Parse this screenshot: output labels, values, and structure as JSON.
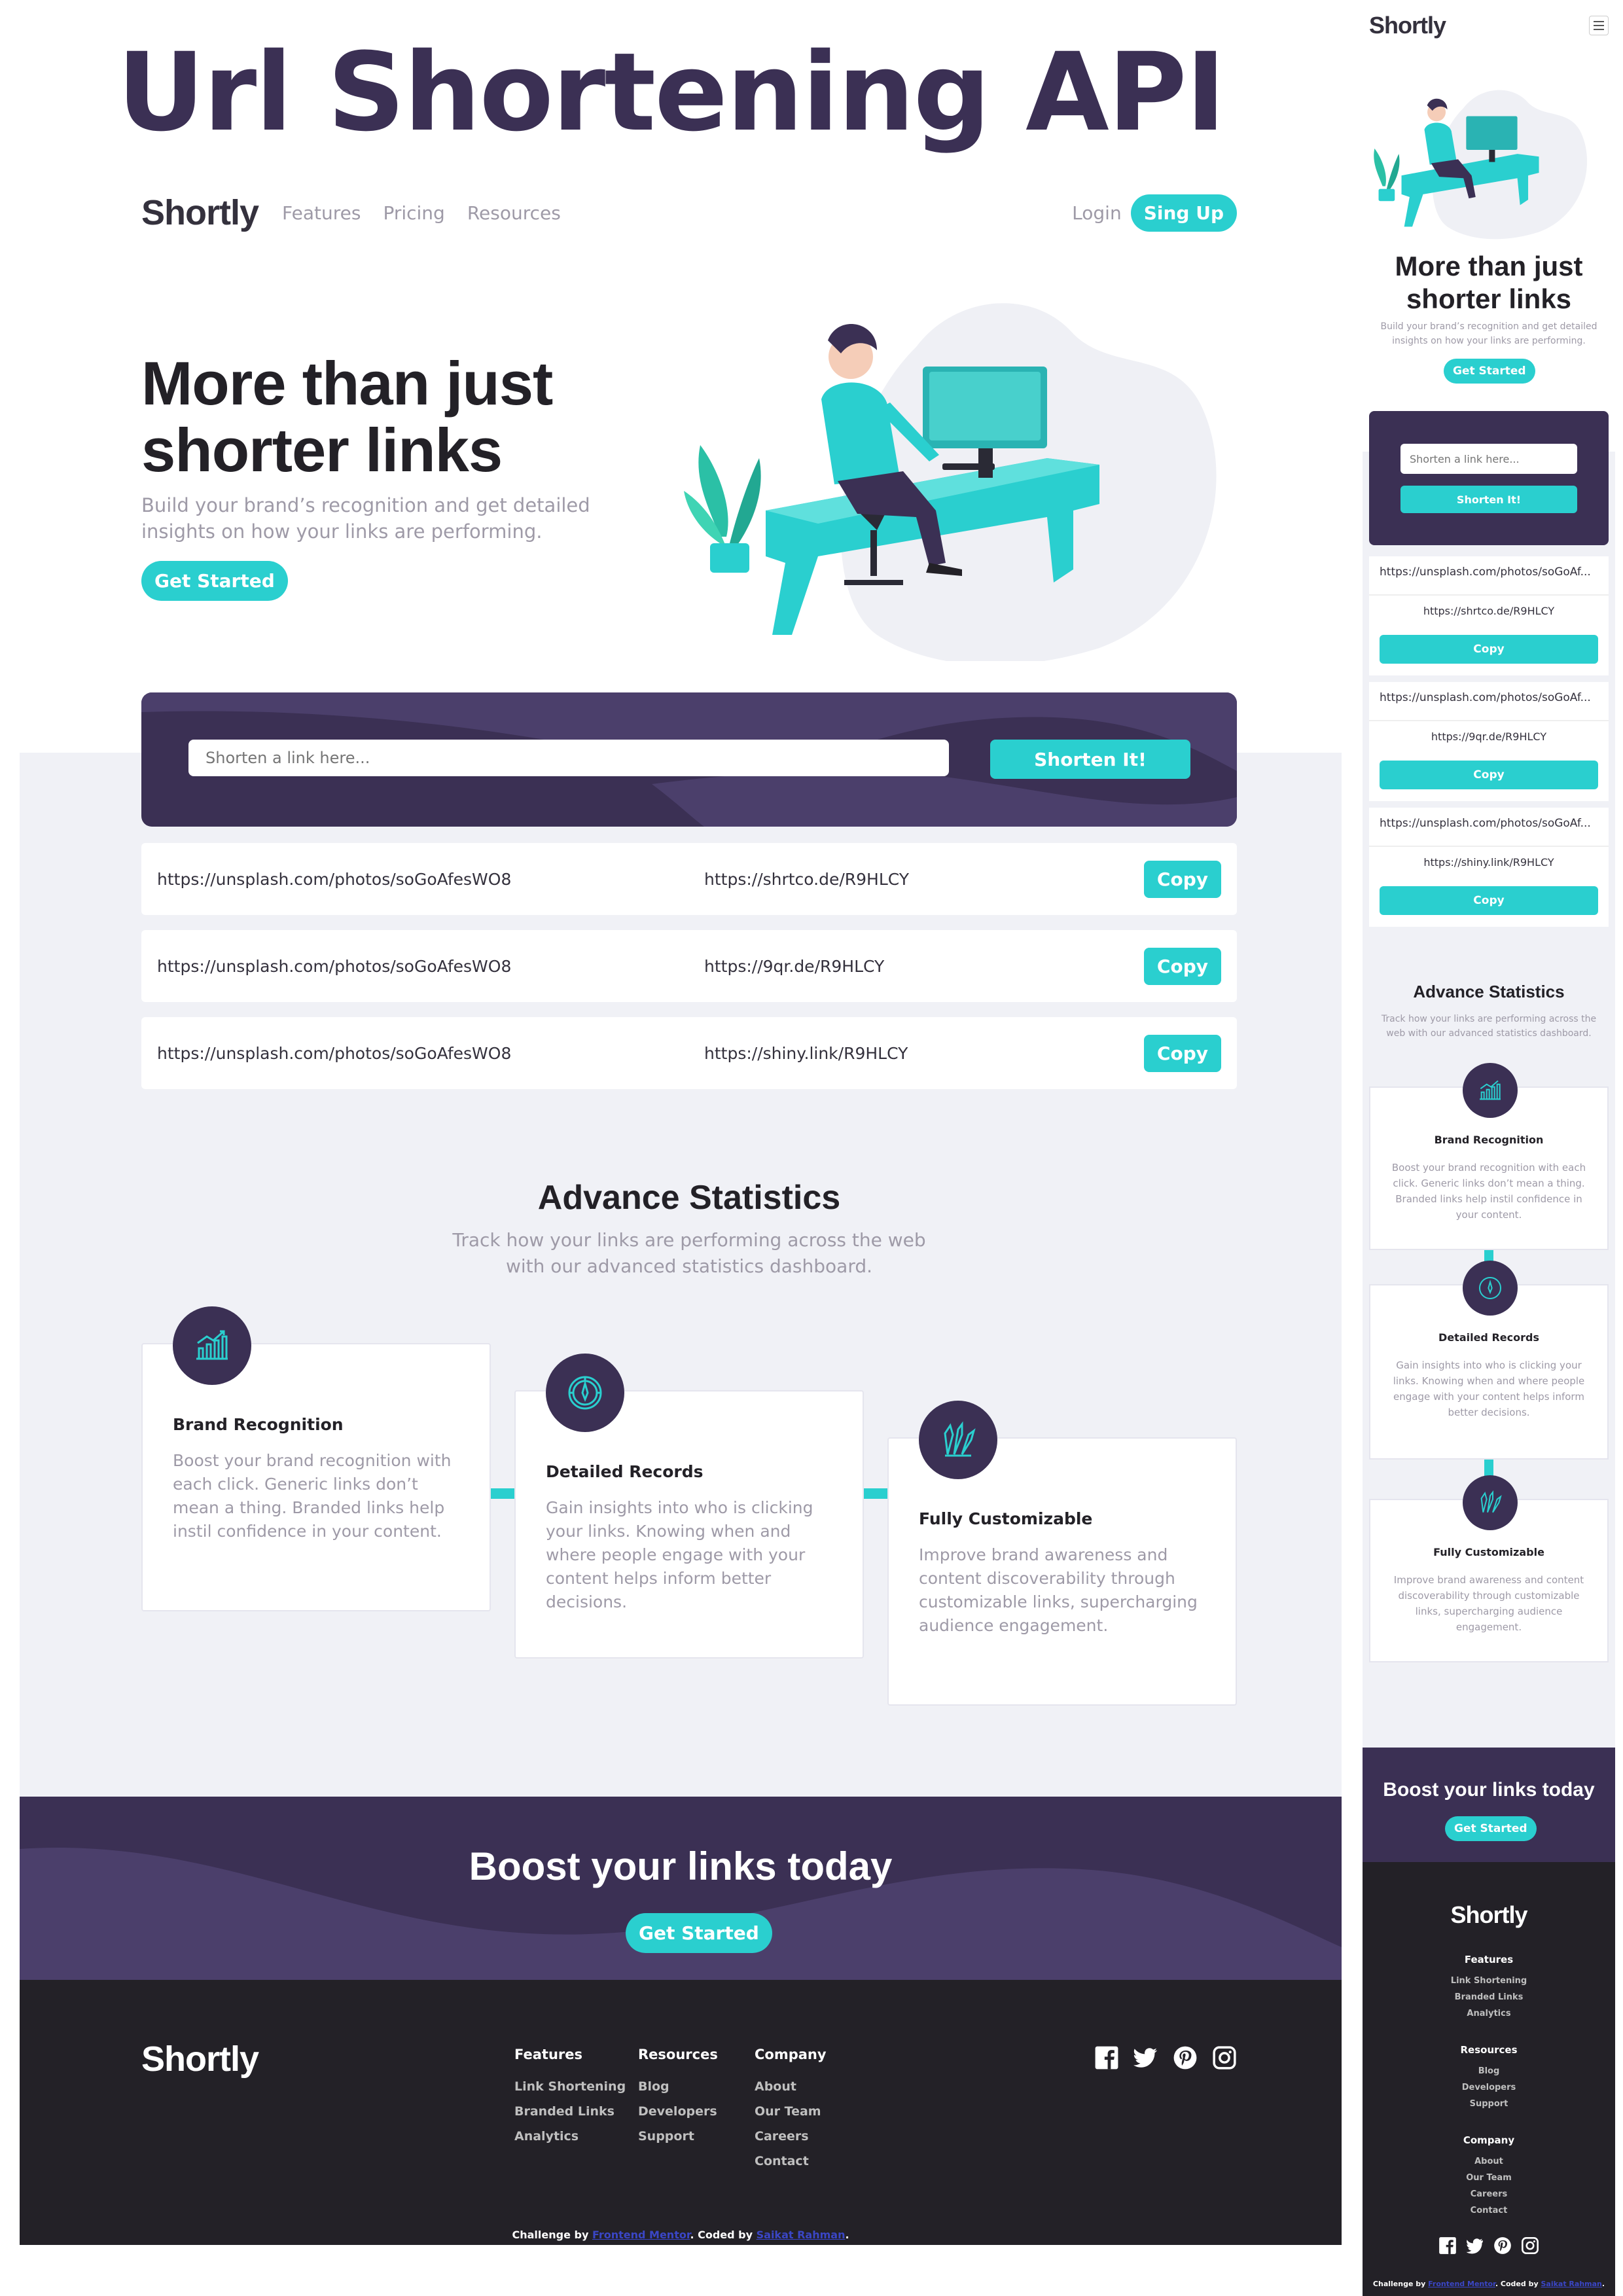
{
  "page_title": "Url Shortening API",
  "brand": "Shortly",
  "nav": {
    "links": [
      "Features",
      "Pricing",
      "Resources"
    ],
    "login": "Login",
    "signup": "Sing Up"
  },
  "hero": {
    "title": "More than just shorter links",
    "subtitle": "Build your brand’s recognition and get detailed insights on how your links are performing.",
    "cta": "Get Started"
  },
  "shorten": {
    "placeholder": "Shorten a link here...",
    "button": "Shorten It!"
  },
  "results": [
    {
      "original": "https://unsplash.com/photos/soGoAfesWO8",
      "short": "https://shrtco.de/R9HLCY",
      "copy": "Copy"
    },
    {
      "original": "https://unsplash.com/photos/soGoAfesWO8",
      "short": "https://9qr.de/R9HLCY",
      "copy": "Copy"
    },
    {
      "original": "https://unsplash.com/photos/soGoAfesWO8",
      "short": "https://shiny.link/R9HLCY",
      "copy": "Copy"
    }
  ],
  "stats": {
    "title": "Advance Statistics",
    "subtitle": "Track how your links are performing across the web with our advanced statistics dashboard.",
    "cards": [
      {
        "icon": "brand-recognition-icon",
        "title": "Brand Recognition",
        "text": "Boost your brand recognition with each click. Generic links don’t mean a thing. Branded links help instil confidence in your content."
      },
      {
        "icon": "detailed-records-icon",
        "title": "Detailed Records",
        "text": "Gain insights into who is clicking your links. Knowing when and where people engage with your content helps inform better decisions."
      },
      {
        "icon": "fully-customizable-icon",
        "title": "Fully Customizable",
        "text": "Improve brand awareness and content discoverability through customizable links, supercharging audience engagement."
      }
    ]
  },
  "boost": {
    "title": "Boost your links today",
    "cta": "Get Started"
  },
  "footer": {
    "columns": [
      {
        "title": "Features",
        "links": [
          "Link Shortening",
          "Branded Links",
          "Analytics"
        ]
      },
      {
        "title": "Resources",
        "links": [
          "Blog",
          "Developers",
          "Support"
        ]
      },
      {
        "title": "Company",
        "links": [
          "About",
          "Our Team",
          "Careers",
          "Contact"
        ]
      }
    ],
    "social": [
      "facebook-icon",
      "twitter-icon",
      "pinterest-icon",
      "instagram-icon"
    ],
    "credit": {
      "challenge_prefix": "Challenge by ",
      "challenge_link": "Frontend Mentor",
      "coded_prefix": ". Coded by ",
      "coded_link": "Saikat Rahman",
      "suffix": "."
    }
  },
  "mobile": {
    "results_original_truncated": "https://unsplash.com/photos/soGoAf..."
  },
  "colors": {
    "cyan": "#2acfcf",
    "dark_violet": "#3b3054",
    "very_dark_violet": "#232127",
    "gray": "#9e9aa7",
    "light_gray": "#f0f1f6"
  }
}
